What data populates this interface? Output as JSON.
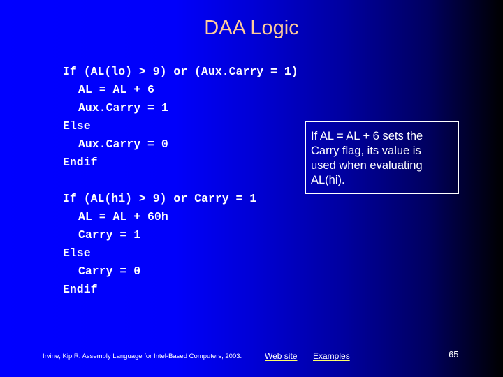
{
  "slide": {
    "title": "DAA Logic",
    "title_color": "#ffcc99",
    "background": {
      "type": "horizontal-gradient",
      "from": "#0000ff",
      "to": "#000000"
    }
  },
  "code_blocks": [
    {
      "lines": [
        {
          "text": "If (AL(lo) > 9) or (Aux.Carry = 1)",
          "indent": false
        },
        {
          "text": "AL = AL + 6",
          "indent": true
        },
        {
          "text": "Aux.Carry = 1",
          "indent": true
        },
        {
          "text": "Else",
          "indent": false
        },
        {
          "text": "Aux.Carry = 0",
          "indent": true
        },
        {
          "text": "Endif",
          "indent": false
        }
      ]
    },
    {
      "lines": [
        {
          "text": "If (AL(hi) > 9) or Carry = 1",
          "indent": false
        },
        {
          "text": "AL = AL + 60h",
          "indent": true
        },
        {
          "text": "Carry = 1",
          "indent": true
        },
        {
          "text": "Else",
          "indent": false
        },
        {
          "text": "Carry = 0",
          "indent": true
        },
        {
          "text": "Endif",
          "indent": false
        }
      ]
    }
  ],
  "callout": {
    "lines": [
      "If AL = AL + 6 sets the",
      "Carry flag, its value is",
      "used when evaluating",
      "AL(hi)."
    ]
  },
  "footer": {
    "citation": "Irvine, Kip R. Assembly Language for Intel-Based Computers, 2003.",
    "links": [
      {
        "label": "Web site"
      },
      {
        "label": "Examples"
      }
    ],
    "link_underline_color": "#ffff66",
    "page_number": "65"
  }
}
